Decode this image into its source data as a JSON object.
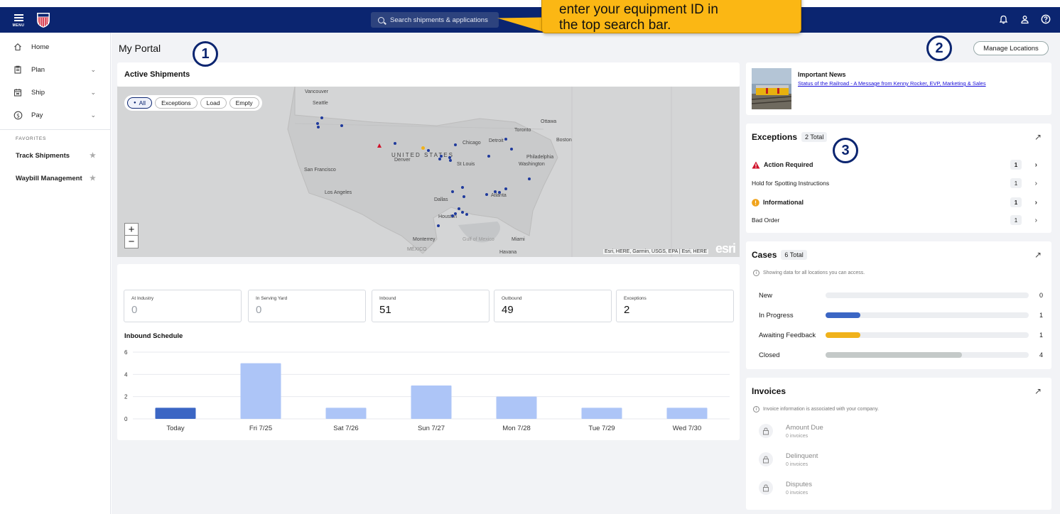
{
  "topbar": {
    "menu_label": "MENU",
    "search_placeholder": "Search shipments & applications"
  },
  "callout": {
    "line1": "enter your equipment ID in",
    "line2": "the top search bar."
  },
  "sidebar": {
    "items": [
      {
        "label": "Home"
      },
      {
        "label": "Plan"
      },
      {
        "label": "Ship"
      },
      {
        "label": "Pay"
      }
    ],
    "favorites_title": "FAVORITES",
    "favorites": [
      {
        "label": "Track Shipments"
      },
      {
        "label": "Waybill Management"
      }
    ]
  },
  "main": {
    "page_title": "My Portal",
    "manage_locations": "Manage Locations",
    "markers": [
      "1",
      "2",
      "3"
    ]
  },
  "active_shipments": {
    "title": "Active Shipments",
    "filters": [
      "All",
      "Exceptions",
      "Load",
      "Empty"
    ],
    "map_labels": [
      "Vancouver",
      "Seattle",
      "Ottawa",
      "Toronto",
      "Boston",
      "Chicago",
      "Detroit",
      "UNITED STATES",
      "Denver",
      "St Louis",
      "Philadelphia",
      "Washington",
      "San Francisco",
      "Los Angeles",
      "Dallas",
      "Atlanta",
      "Houston",
      "Monterrey",
      "Gulf of Mexico",
      "MÉXICO",
      "Miami",
      "Havana"
    ],
    "attribution": "Esri, HERE, Garmin, USGS, EPA | Esri, HERE",
    "esri_logo": "esri"
  },
  "stats": [
    {
      "label": "At Industry",
      "value": "0"
    },
    {
      "label": "In Serving Yard",
      "value": "0"
    },
    {
      "label": "Inbound",
      "value": "51"
    },
    {
      "label": "Outbound",
      "value": "49"
    },
    {
      "label": "Exceptions",
      "value": "2"
    }
  ],
  "inbound_schedule": {
    "title": "Inbound Schedule"
  },
  "chart_data": {
    "type": "bar",
    "categories": [
      "Today",
      "Fri 7/25",
      "Sat 7/26",
      "Sun 7/27",
      "Mon 7/28",
      "Tue 7/29",
      "Wed 7/30"
    ],
    "values": [
      1,
      5,
      1,
      3,
      2,
      1,
      1
    ],
    "yticks": [
      "0",
      "2",
      "4",
      "6"
    ],
    "ylim": [
      0,
      6
    ],
    "colors": {
      "highlight": "#3b66c4",
      "normal": "#adc5f7"
    }
  },
  "news": {
    "title": "Important News",
    "link": "Status of the Railroad - A Message from Kenny Rocker, EVP, Marketing & Sales"
  },
  "exceptions": {
    "title": "Exceptions",
    "total": "2 Total",
    "rows": [
      {
        "label": "Action Required",
        "count": "1",
        "bold": true
      },
      {
        "label": "Hold for Spotting Instructions",
        "count": "1",
        "bold": false
      },
      {
        "label": "Informational",
        "count": "1",
        "bold": true
      },
      {
        "label": "Bad Order",
        "count": "1",
        "bold": false
      }
    ]
  },
  "cases": {
    "title": "Cases",
    "total": "6 Total",
    "note": "Showing data for all locations you can access.",
    "rows": [
      {
        "label": "New",
        "count": "0",
        "fraction": 0,
        "color": "#eceef1"
      },
      {
        "label": "In Progress",
        "count": "1",
        "fraction": 0.17,
        "color": "#3b66c4"
      },
      {
        "label": "Awaiting Feedback",
        "count": "1",
        "fraction": 0.17,
        "color": "#f0b21b"
      },
      {
        "label": "Closed",
        "count": "4",
        "fraction": 0.67,
        "color": "#c4c9c8"
      }
    ]
  },
  "invoices": {
    "title": "Invoices",
    "note": "Invoice information is associated with your company.",
    "rows": [
      {
        "label": "Amount Due",
        "sub": "0 invoices"
      },
      {
        "label": "Delinquent",
        "sub": "0 invoices"
      },
      {
        "label": "Disputes",
        "sub": "0 invoices"
      }
    ]
  }
}
